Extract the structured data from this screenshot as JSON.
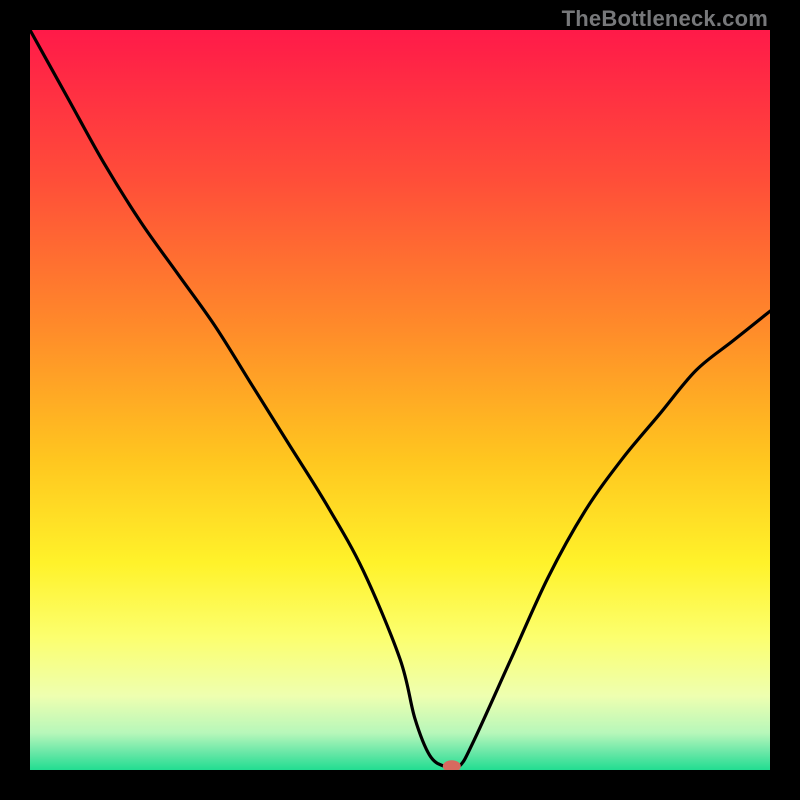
{
  "watermark": "TheBottleneck.com",
  "chart_data": {
    "type": "line",
    "title": "",
    "xlabel": "",
    "ylabel": "",
    "xlim": [
      0,
      100
    ],
    "ylim": [
      0,
      100
    ],
    "curve": {
      "x": [
        0,
        5,
        10,
        15,
        20,
        25,
        30,
        35,
        40,
        45,
        50,
        52,
        54,
        56,
        58,
        60,
        65,
        70,
        75,
        80,
        85,
        90,
        95,
        100
      ],
      "y": [
        100,
        91,
        82,
        74,
        67,
        60,
        52,
        44,
        36,
        27,
        15,
        7,
        2,
        0.5,
        0.5,
        4,
        15,
        26,
        35,
        42,
        48,
        54,
        58,
        62
      ]
    },
    "marker": {
      "x": 57,
      "y": 0.5,
      "color": "#d66a5f"
    },
    "background_gradient": {
      "stops": [
        {
          "offset": 0.0,
          "color": "#ff1a49"
        },
        {
          "offset": 0.2,
          "color": "#ff4d39"
        },
        {
          "offset": 0.4,
          "color": "#ff8a2a"
        },
        {
          "offset": 0.58,
          "color": "#ffc61f"
        },
        {
          "offset": 0.72,
          "color": "#fff22a"
        },
        {
          "offset": 0.82,
          "color": "#fcff6e"
        },
        {
          "offset": 0.9,
          "color": "#eeffb0"
        },
        {
          "offset": 0.95,
          "color": "#b7f7ba"
        },
        {
          "offset": 0.975,
          "color": "#6de8a8"
        },
        {
          "offset": 1.0,
          "color": "#22dd91"
        }
      ]
    }
  }
}
